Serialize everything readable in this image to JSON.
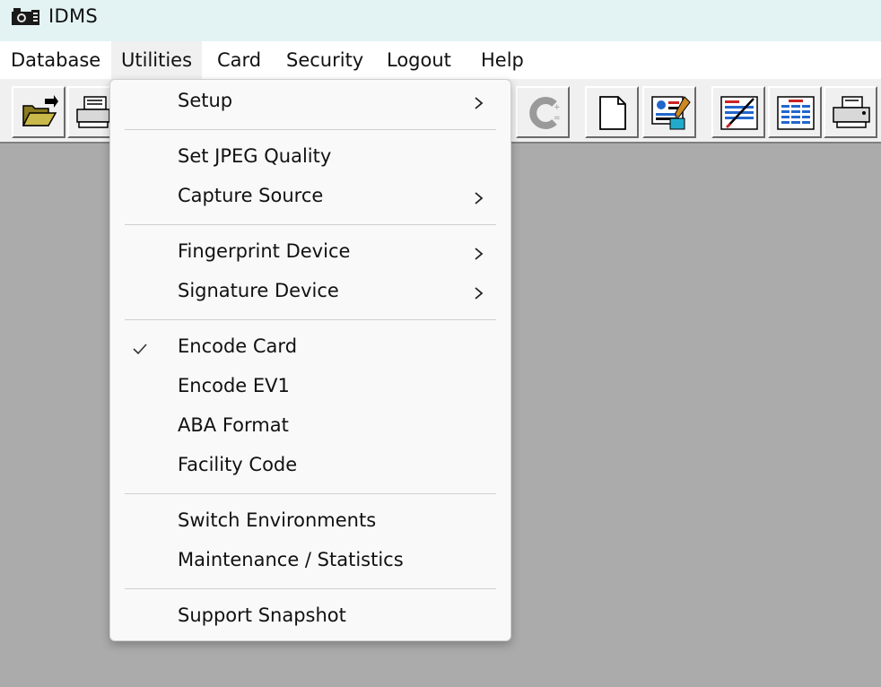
{
  "window": {
    "title": "IDMS"
  },
  "menubar": {
    "items": [
      {
        "label": "Database"
      },
      {
        "label": "Utilities"
      },
      {
        "label": "Card"
      },
      {
        "label": "Security"
      },
      {
        "label": "Logout"
      },
      {
        "label": "Help"
      }
    ]
  },
  "toolbar": {
    "buttons": [
      {
        "icon": "open-folder-icon"
      },
      {
        "icon": "printer-icon"
      },
      {
        "icon": "capture-icon"
      },
      {
        "icon": "new-document-icon"
      },
      {
        "icon": "edit-record-icon"
      },
      {
        "icon": "signature-icon"
      },
      {
        "icon": "report-icon"
      },
      {
        "icon": "card-printer-icon"
      }
    ]
  },
  "utilities_menu": {
    "items": [
      {
        "label": "Setup",
        "submenu": true
      },
      {
        "label": "Set JPEG Quality"
      },
      {
        "label": "Capture Source",
        "submenu": true
      },
      {
        "label": "Fingerprint Device",
        "submenu": true
      },
      {
        "label": "Signature Device",
        "submenu": true
      },
      {
        "label": "Encode Card",
        "checked": true
      },
      {
        "label": "Encode EV1"
      },
      {
        "label": "ABA Format"
      },
      {
        "label": "Facility Code"
      },
      {
        "label": "Switch Environments"
      },
      {
        "label": "Maintenance / Statistics"
      },
      {
        "label": "Support Snapshot"
      }
    ]
  },
  "colors": {
    "titlebar": "#e3f3f3",
    "menubar": "#ffffff",
    "workspace": "#ababab",
    "menu_background": "#f9f9f9"
  }
}
